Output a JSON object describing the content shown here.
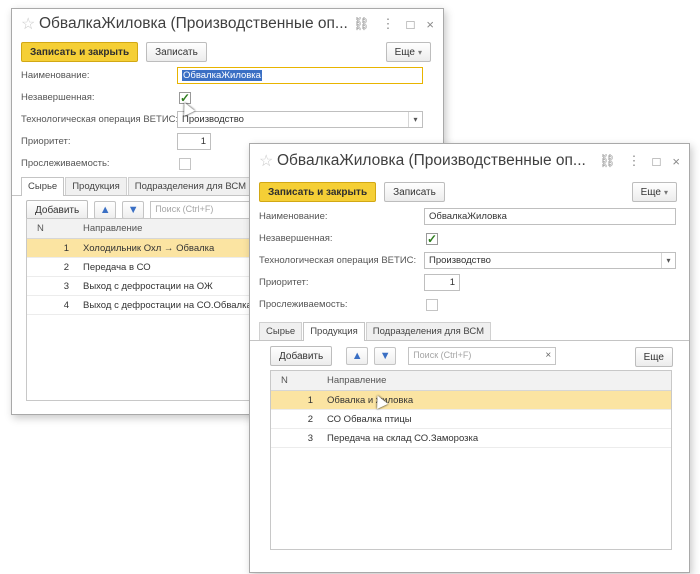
{
  "back_window": {
    "title": "ОбвалкаЖиловка (Производственные оп...",
    "title_icons": {
      "link": "⛓",
      "menu": "⋮",
      "maximize": "□",
      "close": "×"
    },
    "toolbar": {
      "save_close": "Записать и закрыть",
      "save": "Записать",
      "more": "Еще"
    },
    "fields": {
      "name_label": "Наименование:",
      "name_value": "ОбвалкаЖиловка",
      "incomplete_label": "Незавершенная:",
      "vetis_label": "Технологическая операция ВЕТИС:",
      "vetis_value": "Производство",
      "priority_label": "Приоритет:",
      "priority_value": "1",
      "trace_label": "Прослеживаемость:"
    },
    "tabs": [
      "Сырье",
      "Продукция",
      "Подразделения для ВСМ"
    ],
    "add_button": "Добавить",
    "search_placeholder": "Поиск (Ctrl+F)",
    "table": {
      "headers": [
        "N",
        "Направление"
      ],
      "rows": [
        {
          "n": "1",
          "text": "Холодильник Охл → Обвалка"
        },
        {
          "n": "2",
          "text": "Передача в СО"
        },
        {
          "n": "3",
          "text": "Выход с дефростации на ОЖ"
        },
        {
          "n": "4",
          "text": "Выход с дефростации на СО.Обвалка"
        }
      ]
    }
  },
  "front_window": {
    "title": "ОбвалкаЖиловка (Производственные оп...",
    "title_icons": {
      "link": "⛓",
      "menu": "⋮",
      "maximize": "□",
      "close": "×"
    },
    "toolbar": {
      "save_close": "Записать и закрыть",
      "save": "Записать",
      "more": "Еще"
    },
    "fields": {
      "name_label": "Наименование:",
      "name_value": "ОбвалкаЖиловка",
      "incomplete_label": "Незавершенная:",
      "vetis_label": "Технологическая операция ВЕТИС:",
      "vetis_value": "Производство",
      "priority_label": "Приоритет:",
      "priority_value": "1",
      "trace_label": "Прослеживаемость:"
    },
    "tabs": [
      "Сырье",
      "Продукция",
      "Подразделения для ВСМ"
    ],
    "add_button": "Добавить",
    "search_placeholder": "Поиск (Ctrl+F)",
    "table_more": "Еще",
    "table": {
      "headers": [
        "N",
        "Направление"
      ],
      "rows": [
        {
          "n": "1",
          "text": "Обвалка и жиловка"
        },
        {
          "n": "2",
          "text": "СО Обвалка птицы"
        },
        {
          "n": "3",
          "text": "Передача на склад СО.Заморозка"
        }
      ]
    }
  },
  "colors": {
    "accent_yellow": "#f5cf36",
    "row_selected": "#fbe4a2",
    "check_green": "#2f7d1f"
  }
}
